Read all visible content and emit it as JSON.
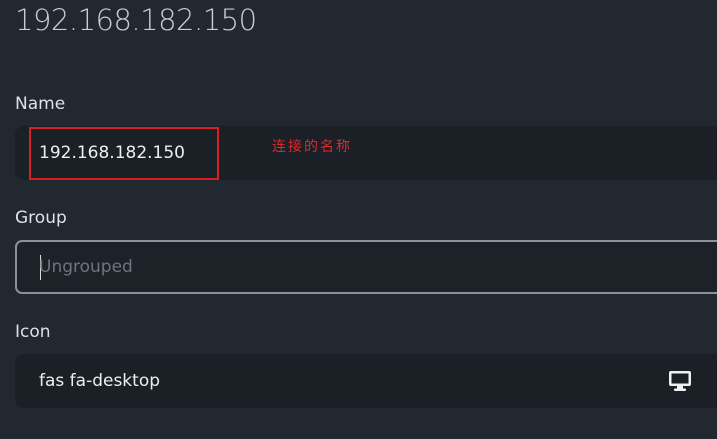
{
  "header": {
    "title": "192.168.182.150"
  },
  "form": {
    "name": {
      "label": "Name",
      "value": "192.168.182.150",
      "annotation": "连接的名称",
      "annotation_color": "#e0262a"
    },
    "group": {
      "label": "Group",
      "value": "",
      "placeholder": "Ungrouped",
      "focused": true
    },
    "icon": {
      "label": "Icon",
      "value": "fas fa-desktop",
      "preview_icon": "desktop-icon"
    }
  },
  "colors": {
    "background": "#212830",
    "field_background": "#1b2027",
    "focus_border": "#8b9199",
    "highlight": "#d81f26"
  }
}
